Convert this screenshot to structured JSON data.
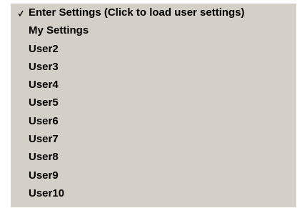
{
  "menu": {
    "items": [
      {
        "label": "Enter Settings (Click to load user settings)",
        "checked": true
      },
      {
        "label": "My Settings",
        "checked": false
      },
      {
        "label": "User2",
        "checked": false
      },
      {
        "label": "User3",
        "checked": false
      },
      {
        "label": "User4",
        "checked": false
      },
      {
        "label": "User5",
        "checked": false
      },
      {
        "label": "User6",
        "checked": false
      },
      {
        "label": "User7",
        "checked": false
      },
      {
        "label": "User8",
        "checked": false
      },
      {
        "label": "User9",
        "checked": false
      },
      {
        "label": "User10",
        "checked": false
      }
    ]
  },
  "colors": {
    "menu_background": "#d4d0c8",
    "text": "#000000"
  },
  "icons": {
    "checked_item": "checkmark-icon"
  }
}
